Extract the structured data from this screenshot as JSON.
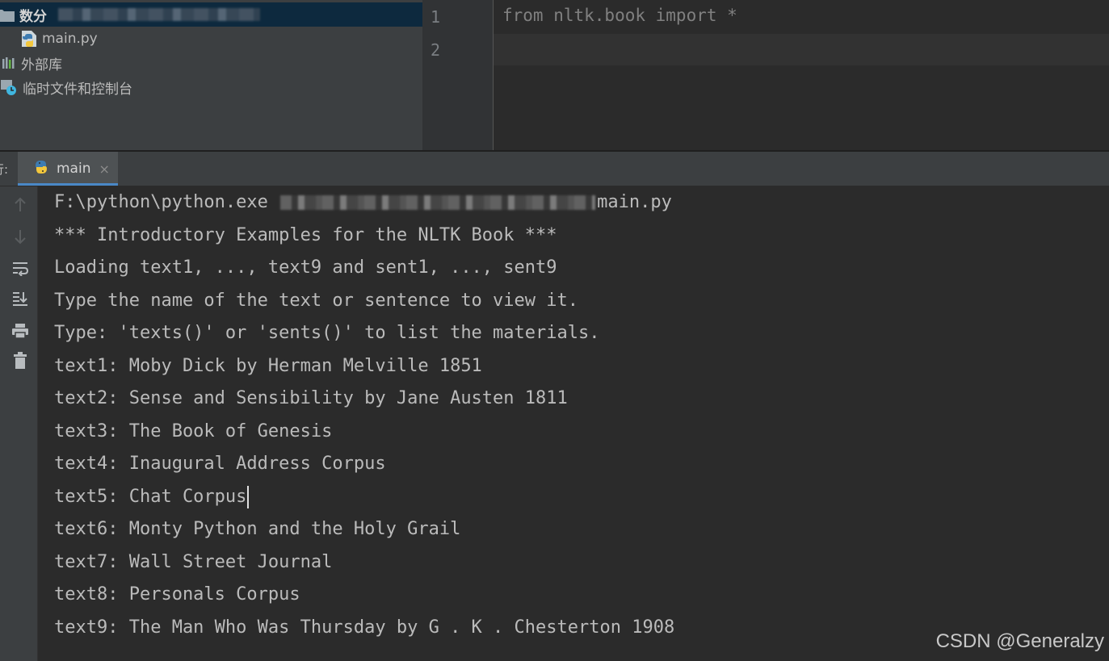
{
  "project_tree": {
    "root_label": "数分",
    "file_label": "main.py",
    "external_libs_label": "外部库",
    "scratches_label": "临时文件和控制台"
  },
  "editor": {
    "line_numbers": [
      "1",
      "2"
    ],
    "code_line_1": "from nltk.book import *"
  },
  "run_window": {
    "cut_label": "行:",
    "tab_label": "main",
    "tab_close": "×"
  },
  "console": {
    "cmd_prefix": "F:\\python\\python.exe ",
    "cmd_suffix": "main.py",
    "lines": [
      "*** Introductory Examples for the NLTK Book ***",
      "Loading text1, ..., text9 and sent1, ..., sent9",
      "Type the name of the text or sentence to view it.",
      "Type: 'texts()' or 'sents()' to list the materials.",
      "text1: Moby Dick by Herman Melville 1851",
      "text2: Sense and Sensibility by Jane Austen 1811",
      "text3: The Book of Genesis",
      "text4: Inaugural Address Corpus",
      "text5: Chat Corpus",
      "text6: Monty Python and the Holy Grail",
      "text7: Wall Street Journal",
      "text8: Personals Corpus",
      "text9: The Man Who Was Thursday by G . K . Chesterton 1908"
    ]
  },
  "watermark": "CSDN @Generalzy",
  "colors": {
    "accent": "#4a88c7",
    "python_blue": "#3e7cb1",
    "python_yellow": "#f3c73c"
  },
  "icons": {
    "folder": "folder-icon",
    "python_file": "python-file-icon",
    "libraries": "libraries-icon",
    "scratches": "scratches-icon",
    "up": "arrow-up-icon",
    "down": "arrow-down-icon",
    "wrap": "soft-wrap-icon",
    "scroll_end": "scroll-to-end-icon",
    "print": "print-icon",
    "trash": "trash-icon"
  }
}
